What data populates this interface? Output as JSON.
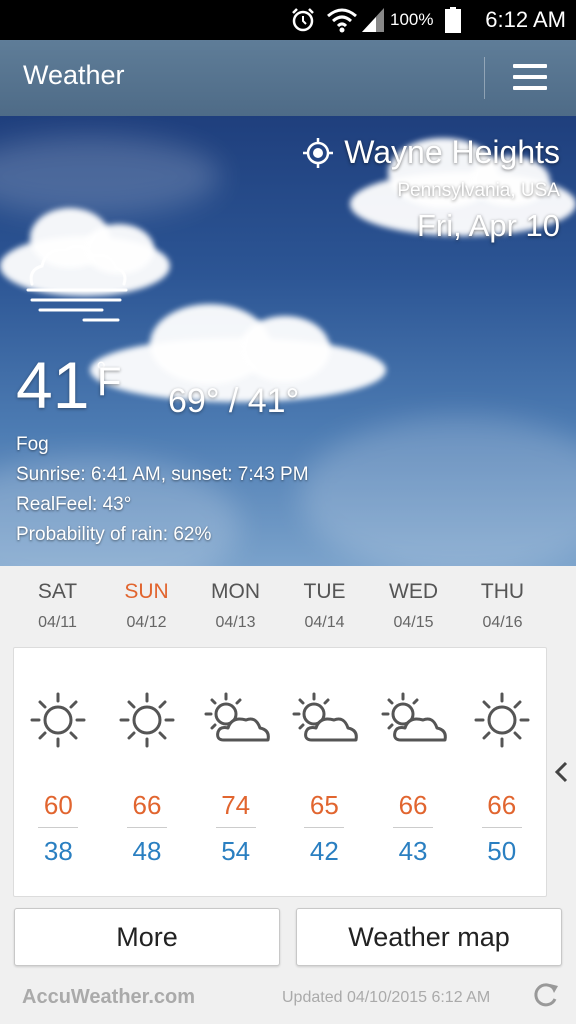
{
  "status_bar": {
    "battery": "100%",
    "time": "6:12 AM"
  },
  "app_bar": {
    "title": "Weather"
  },
  "current": {
    "location": "Wayne Heights",
    "region": "Pennsylvania, USA",
    "date": "Fri, Apr 10",
    "temp": "41",
    "deg": "°",
    "unit": "F",
    "hilo": "69° / 41°",
    "condition": "Fog",
    "sun": "Sunrise: 6:41  AM, sunset: 7:43  PM",
    "realfeel": "RealFeel: 43°",
    "rain": "Probability of rain: 62%",
    "icon": "fog-icon"
  },
  "forecast": [
    {
      "day": "SAT",
      "date": "04/11",
      "high": "60",
      "low": "38",
      "icon": "sunny-icon"
    },
    {
      "day": "SUN",
      "date": "04/12",
      "high": "66",
      "low": "48",
      "icon": "sunny-icon"
    },
    {
      "day": "MON",
      "date": "04/13",
      "high": "74",
      "low": "54",
      "icon": "partly-cloudy-icon"
    },
    {
      "day": "TUE",
      "date": "04/14",
      "high": "65",
      "low": "42",
      "icon": "partly-cloudy-icon"
    },
    {
      "day": "WED",
      "date": "04/15",
      "high": "66",
      "low": "43",
      "icon": "partly-cloudy-icon"
    },
    {
      "day": "THU",
      "date": "04/16",
      "high": "66",
      "low": "50",
      "icon": "sunny-icon"
    }
  ],
  "buttons": {
    "more": "More",
    "map": "Weather map"
  },
  "footer": {
    "logo": "AccuWeather.com",
    "updated": "Updated 04/10/2015 6:12 AM"
  },
  "colors": {
    "high": "#e1652f",
    "low": "#2a7fc1",
    "sunday": "#e1652f",
    "appbar": "#56738f"
  }
}
